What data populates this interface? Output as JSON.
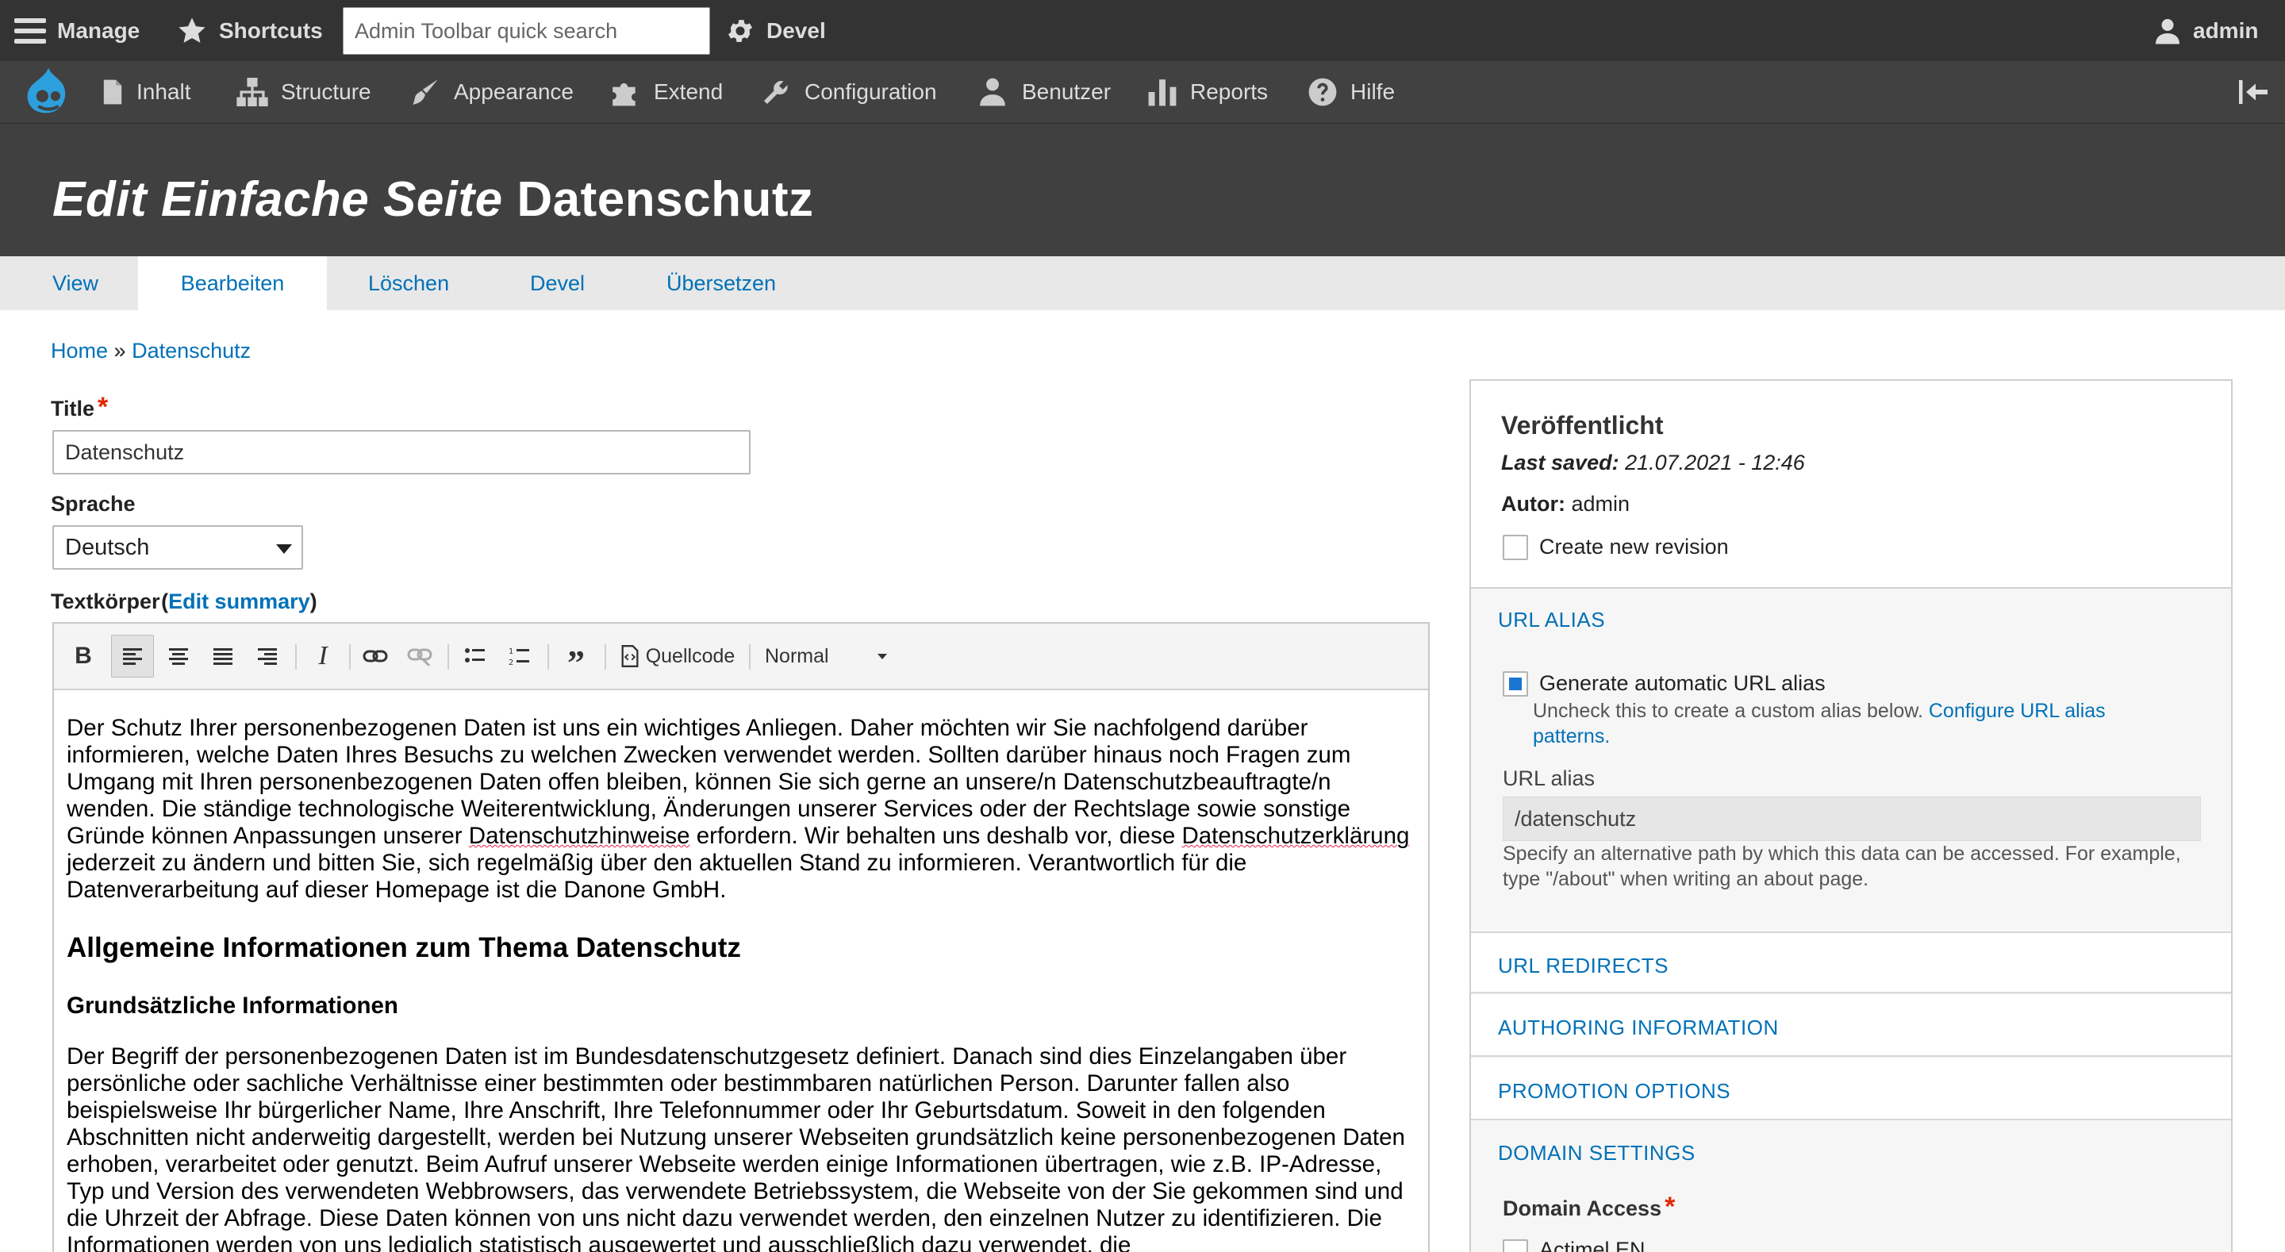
{
  "admin_toolbar": {
    "manage_label": "Manage",
    "shortcuts_label": "Shortcuts",
    "search_placeholder": "Admin Toolbar quick search",
    "devel_label": "Devel",
    "user_label": "admin"
  },
  "tray": {
    "items": [
      {
        "label": "Inhalt",
        "icon": "file-icon"
      },
      {
        "label": "Structure",
        "icon": "structure-icon"
      },
      {
        "label": "Appearance",
        "icon": "brush-icon"
      },
      {
        "label": "Extend",
        "icon": "puzzle-icon"
      },
      {
        "label": "Configuration",
        "icon": "wrench-icon"
      },
      {
        "label": "Benutzer",
        "icon": "people-icon"
      },
      {
        "label": "Reports",
        "icon": "bar-chart-icon"
      },
      {
        "label": "Hilfe",
        "icon": "help-icon"
      }
    ]
  },
  "page": {
    "title_italic": "Edit Einfache Seite",
    "title_rest": "Datenschutz"
  },
  "tabs": [
    "View",
    "Bearbeiten",
    "Löschen",
    "Devel",
    "Übersetzen"
  ],
  "breadcrumb": {
    "home": "Home",
    "sep": "»",
    "current": "Datenschutz"
  },
  "form": {
    "title_label": "Title",
    "title_value": "Datenschutz",
    "language_label": "Sprache",
    "language_value": "Deutsch",
    "body_label": "Textkörper",
    "edit_summary": "Edit summary",
    "toolbar": {
      "source_label": "Quellcode",
      "format_label": "Normal"
    }
  },
  "body": {
    "p1_a": "Der Schutz Ihrer personenbezogenen Daten ist uns ein wichtiges Anliegen. Daher möchten wir Sie nachfolgend darüber informieren, welche Daten Ihres Besuchs zu welchen Zwecken verwendet werden. Sollten darüber hinaus noch Fragen zum Umgang mit Ihren personenbezogenen Daten offen bleiben, können Sie sich gerne an unsere/n Datenschutzbeauftragte/n wenden. Die ständige technologische Weiterentwicklung, Änderungen unserer Services oder der Rechtslage sowie sonstige Gründe können Anpassungen unserer ",
    "p1_sp1": "Datenschutzhinweise",
    "p1_b": " erfordern. Wir behalten uns deshalb vor, diese ",
    "p1_sp2": "Datenschutzerklärung",
    "p1_c": " jederzeit zu ändern und bitten Sie, sich regelmäßig über den aktuellen Stand zu informieren. Verantwortlich für die Datenverarbeitung auf dieser Homepage ist die Danone GmbH.",
    "h2": "Allgemeine Informationen zum Thema Datenschutz",
    "h3": "Grundsätzliche Informationen",
    "p2": "Der Begriff der personenbezogenen Daten ist im Bundesdatenschutzgesetz definiert. Danach sind dies Einzelangaben über persönliche oder sachliche Verhältnisse einer bestimmten oder bestimmbaren natürlichen Person. Darunter fallen also beispielsweise Ihr bürgerlicher Name, Ihre Anschrift, Ihre Telefonnummer oder Ihr Geburtsdatum. Soweit in den folgenden Abschnitten nicht anderweitig dargestellt, werden bei Nutzung unserer Webseiten grundsätzlich keine personenbezogenen Daten erhoben, verarbeitet oder genutzt. Beim Aufruf unserer Webseite werden einige Informationen übertragen, wie z.B. IP-Adresse, Typ und Version des verwendeten Webbrowsers, das verwendete Betriebssystem, die Webseite von der Sie gekommen sind und die Uhrzeit der Abfrage. Diese Daten können von uns nicht dazu verwendet werden, den einzelnen Nutzer zu identifizieren. Die Informationen werden von uns lediglich statistisch ausgewertet und ausschließlich dazu verwendet, die"
  },
  "sidebar": {
    "status": "Veröffentlicht",
    "last_saved_label": "Last saved:",
    "last_saved_value": "21.07.2021 - 12:46",
    "author_label": "Autor:",
    "author_value": "admin",
    "revision_label": "Create new revision",
    "url_alias_title": "URL ALIAS",
    "generate_alias_label": "Generate automatic URL alias",
    "generate_alias_desc": "Uncheck this to create a custom alias below.",
    "configure_link_1": "Configure URL alias",
    "configure_link_2": "patterns.",
    "url_alias_label": "URL alias",
    "url_alias_value": "/datenschutz",
    "url_alias_desc_1": "Specify an alternative path by which this data can be accessed. For example,",
    "url_alias_desc_2": "type \"/about\" when writing an about page.",
    "url_redirects": "URL REDIRECTS",
    "authoring": "AUTHORING INFORMATION",
    "promotion": "PROMOTION OPTIONS",
    "domain_settings": "DOMAIN SETTINGS",
    "domain_access_label": "Domain Access",
    "domain_first_option": "Actimel EN"
  },
  "colors": {
    "link": "#0071b8",
    "toolbar_bg": "#333333",
    "header_bg": "#404040",
    "required": "#e32700"
  }
}
